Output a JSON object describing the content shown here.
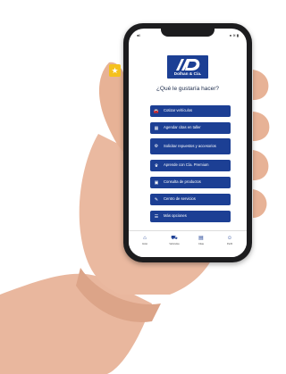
{
  "app": {
    "brand_name": "Dolhan & Cía.",
    "question": "¿Qué le gustaría hacer?"
  },
  "status_bar": {
    "left": "●ll",
    "right": "● ≋ ▮"
  },
  "menu": {
    "items": [
      {
        "label": "Cotizar vehículos",
        "icon": "car-icon"
      },
      {
        "label": "Agendar citas en taller",
        "icon": "calendar-icon"
      },
      {
        "label": "Solicitar repuestos y accesorios",
        "icon": "gear-icon"
      },
      {
        "label": "Aprende con Cía. Premium",
        "icon": "trophy-icon"
      },
      {
        "label": "Consulta de productos",
        "icon": "box-icon"
      },
      {
        "label": "Centro de servicios",
        "icon": "wrench-icon"
      },
      {
        "label": "Más opciones",
        "icon": "menu-icon"
      }
    ]
  },
  "tabs": [
    {
      "label": "Inicio",
      "icon": "home-icon"
    },
    {
      "label": "Vehículos",
      "icon": "car-icon"
    },
    {
      "label": "Citas",
      "icon": "calendar-icon"
    },
    {
      "label": "Perfil",
      "icon": "user-icon"
    }
  ],
  "colors": {
    "brand": "#1c3f94",
    "accent": "#f5c11d"
  }
}
